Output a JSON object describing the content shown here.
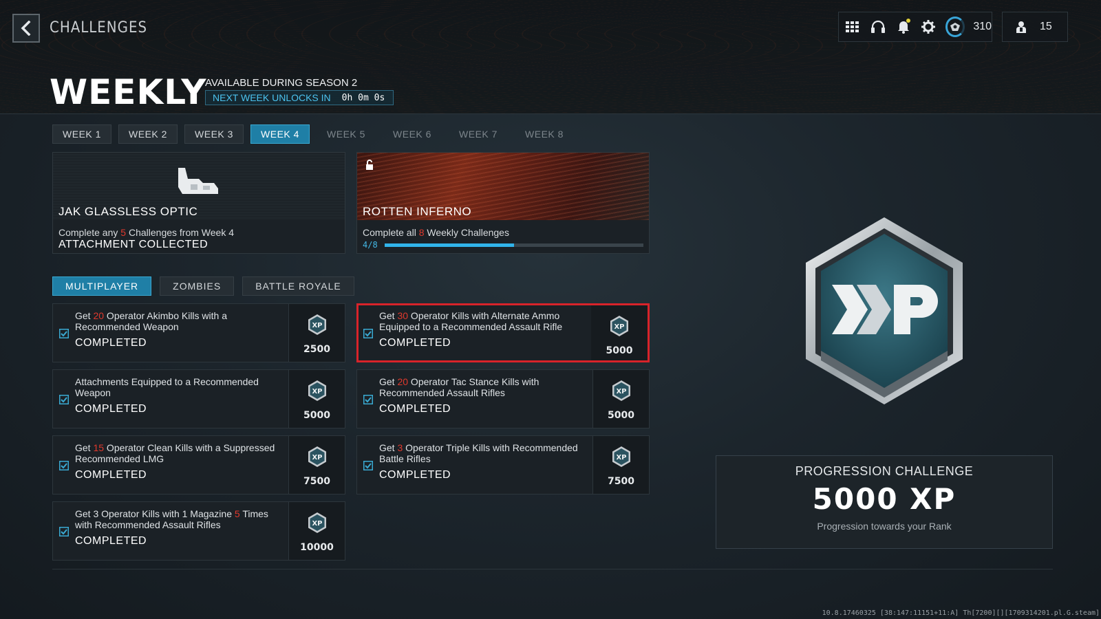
{
  "header": {
    "breadcrumb": "CHALLENGES",
    "title": "WEEKLY",
    "season": "AVAILABLE DURING SEASON 2",
    "unlock_label": "NEXT WEEK UNLOCKS IN",
    "unlock_time": "0h 0m 0s"
  },
  "hud": {
    "level": "310",
    "party_count": "15",
    "icons": [
      "grid-menu-icon",
      "headset-icon",
      "bell-icon",
      "gear-icon",
      "prestige-emblem-icon",
      "party-icon"
    ]
  },
  "weeks": [
    {
      "label": "WEEK 1",
      "state": "unlocked"
    },
    {
      "label": "WEEK 2",
      "state": "unlocked"
    },
    {
      "label": "WEEK 3",
      "state": "unlocked"
    },
    {
      "label": "WEEK 4",
      "state": "active"
    },
    {
      "label": "WEEK 5",
      "state": "locked"
    },
    {
      "label": "WEEK 6",
      "state": "locked"
    },
    {
      "label": "WEEK 7",
      "state": "locked"
    },
    {
      "label": "WEEK 8",
      "state": "locked"
    }
  ],
  "rewards": {
    "optic": {
      "name": "JAK GLASSLESS OPTIC",
      "desc_pre": "Complete any ",
      "desc_num": "5",
      "desc_post": " Challenges from Week 4",
      "status": "ATTACHMENT COLLECTED"
    },
    "inferno": {
      "name": "ROTTEN INFERNO",
      "desc_pre": "Complete all ",
      "desc_num": "8",
      "desc_post": " Weekly Challenges",
      "progress_text": "4/8",
      "progress": 0.5
    }
  },
  "modes": [
    {
      "label": "MULTIPLAYER",
      "active": true
    },
    {
      "label": "ZOMBIES",
      "active": false
    },
    {
      "label": "BATTLE ROYALE",
      "active": false
    }
  ],
  "challenges": [
    {
      "pre": "Get ",
      "num": "20",
      "post": " Operator Akimbo Kills with a Recommended Weapon",
      "status": "COMPLETED",
      "xp": "2500"
    },
    {
      "pre": "Get ",
      "num": "30",
      "post": " Operator Kills with Alternate Ammo Equipped to a Recommended Assault Rifle",
      "status": "COMPLETED",
      "xp": "5000"
    },
    {
      "pre": "",
      "num": "",
      "post": "Attachments Equipped to a Recommended Weapon",
      "status": "COMPLETED",
      "xp": "5000"
    },
    {
      "pre": "Get ",
      "num": "20",
      "post": " Operator Tac Stance Kills with Recommended Assault Rifles",
      "status": "COMPLETED",
      "xp": "5000"
    },
    {
      "pre": "Get ",
      "num": "15",
      "post": " Operator Clean Kills with a Suppressed Recommended LMG",
      "status": "COMPLETED",
      "xp": "7500"
    },
    {
      "pre": "Get ",
      "num": "3",
      "post": " Operator Triple Kills with Recommended Battle Rifles",
      "status": "COMPLETED",
      "xp": "7500"
    },
    {
      "pre": "Get 3 Operator Kills with 1 Magazine ",
      "num": "5",
      "post": " Times with Recommended Assault Rifles",
      "status": "COMPLETED",
      "xp": "10000"
    }
  ],
  "progression": {
    "title": "PROGRESSION CHALLENGE",
    "xp": "5000 XP",
    "subtitle": "Progression towards your Rank"
  },
  "build_info": "10.8.17460325 [38:147:11151+11:A] Th[7200][][1709314201.pl.G.steam]",
  "colors": {
    "accent": "#1f7fa6",
    "accent_text": "#4cc3ef",
    "highlight_red": "#d8232a",
    "number_red": "#e0392d"
  }
}
